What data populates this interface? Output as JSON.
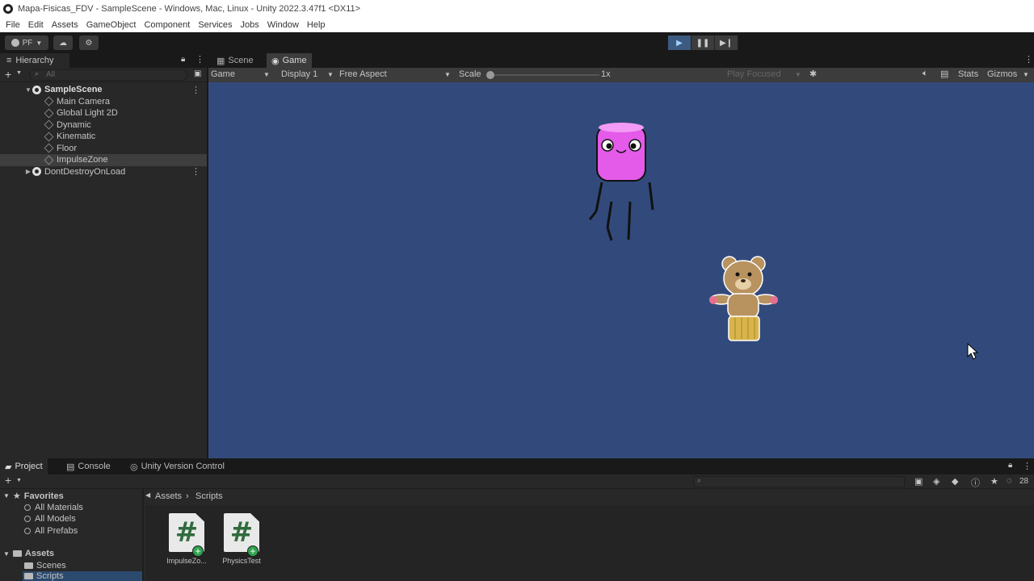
{
  "window": {
    "title": "Mapa-Fisicas_FDV - SampleScene - Windows, Mac, Linux - Unity 2022.3.47f1 <DX11>"
  },
  "menu": [
    "File",
    "Edit",
    "Assets",
    "GameObject",
    "Component",
    "Services",
    "Jobs",
    "Window",
    "Help"
  ],
  "toolbar": {
    "account_label": "PF"
  },
  "hierarchy": {
    "tab_label": "Hierarchy",
    "search_placeholder": "All",
    "scene": "SampleScene",
    "items": [
      "Main Camera",
      "Global Light 2D",
      "Dynamic",
      "Kinematic",
      "Floor",
      "ImpulseZone"
    ],
    "selected_item": "ImpulseZone",
    "dont_destroy": "DontDestroyOnLoad"
  },
  "gameview": {
    "tabs": [
      "Scene",
      "Game"
    ],
    "active_tab": "Game",
    "mode": "Game",
    "display": "Display 1",
    "aspect": "Free Aspect",
    "scale_label": "Scale",
    "scale_value": "1x",
    "play_focused": "Play Focused",
    "stats": "Stats",
    "gizmos": "Gizmos",
    "background_color": "#324a7b"
  },
  "project": {
    "tabs": [
      "Project",
      "Console",
      "Unity Version Control"
    ],
    "favorites_label": "Favorites",
    "favorites": [
      "All Materials",
      "All Models",
      "All Prefabs"
    ],
    "assets_label": "Assets",
    "asset_folders": [
      "Scenes",
      "Scripts"
    ],
    "breadcrumb": [
      "Assets",
      "Scripts"
    ],
    "files": [
      "ImpulseZo...",
      "PhysicsTest"
    ],
    "hidden_count": "28"
  }
}
